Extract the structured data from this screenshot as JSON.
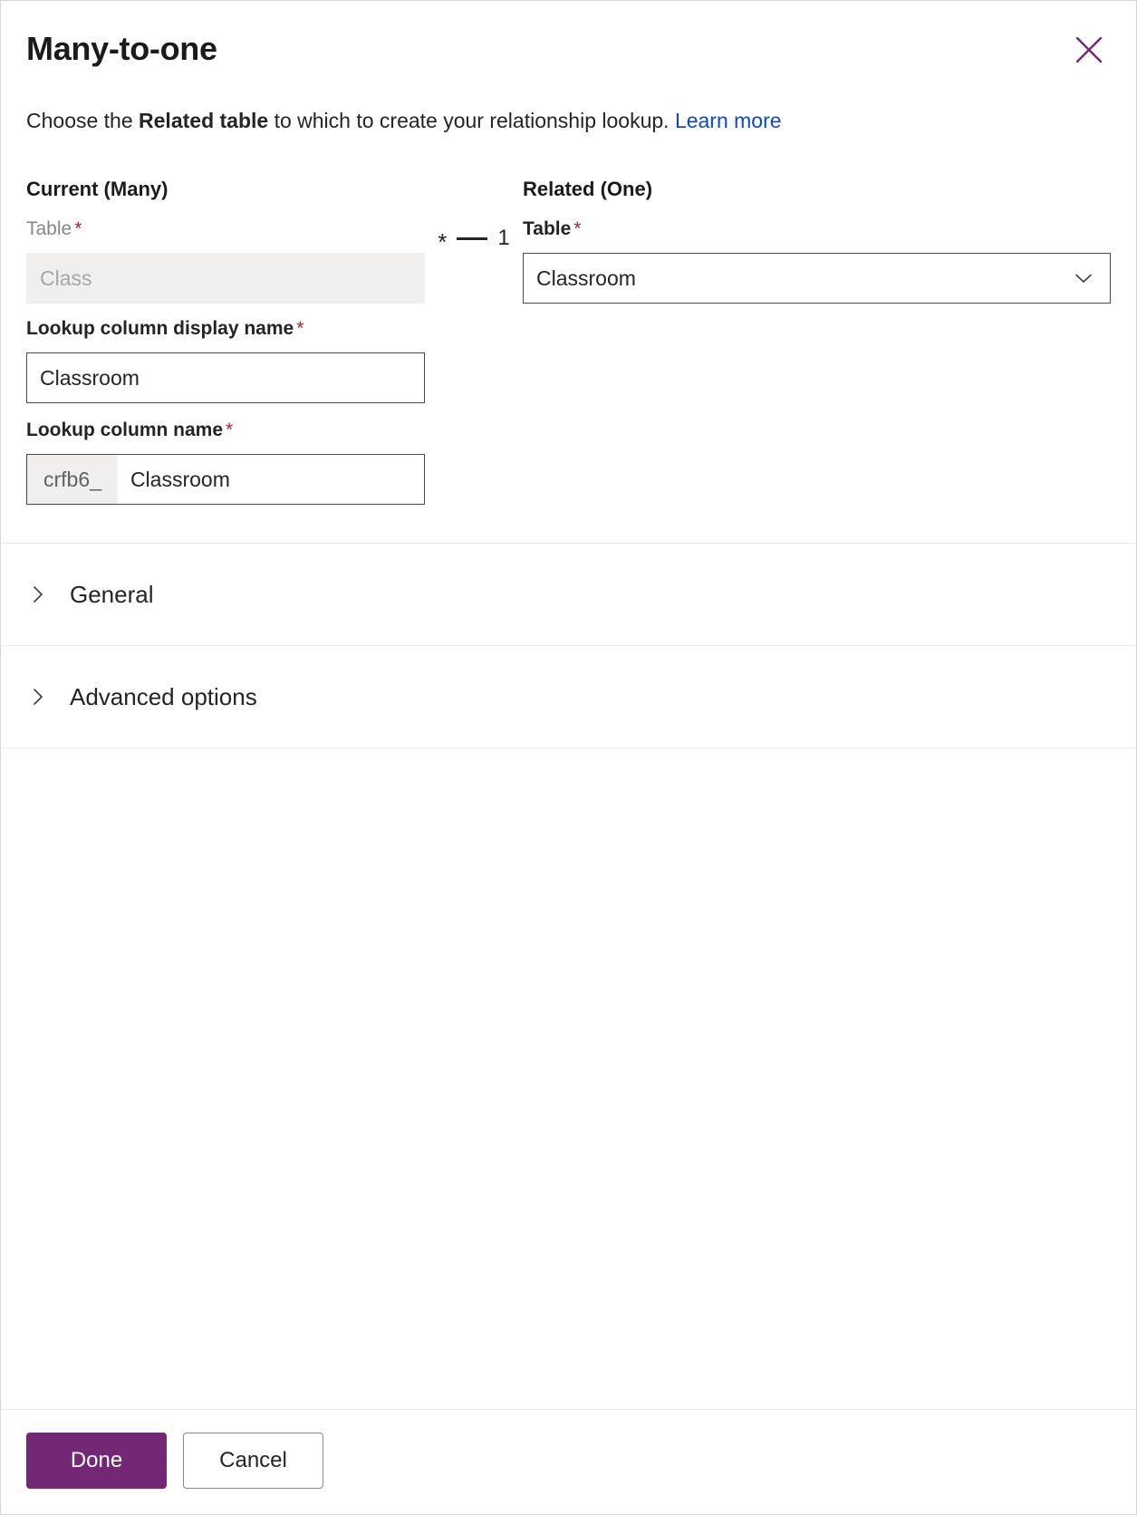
{
  "dialog": {
    "title": "Many-to-one",
    "close_icon": "close-icon",
    "subtitle": {
      "before": "Choose the ",
      "bold": "Related table",
      "after": " to which to create your relationship lookup. ",
      "link": "Learn more"
    }
  },
  "current": {
    "section_title": "Current (Many)",
    "table_label": "Table",
    "table_required": "*",
    "table_value": "Class",
    "table_disabled": true
  },
  "related": {
    "section_title": "Related (One)",
    "table_label": "Table",
    "table_required": "*",
    "table_value": "Classroom",
    "dropdown_icon": "chevron-down-icon"
  },
  "connector": {
    "many": "*",
    "one": "1"
  },
  "lookup_display": {
    "label": "Lookup column display name",
    "required": "*",
    "value": "Classroom"
  },
  "lookup_name": {
    "label": "Lookup column name",
    "required": "*",
    "prefix": "crfb6_",
    "value": "Classroom"
  },
  "accordions": [
    {
      "label": "General",
      "icon": "chevron-right-icon",
      "expanded": false
    },
    {
      "label": "Advanced options",
      "icon": "chevron-right-icon",
      "expanded": false
    }
  ],
  "footer": {
    "done_label": "Done",
    "cancel_label": "Cancel"
  },
  "colors": {
    "brand_purple": "#742774",
    "link_blue": "#0f47c2",
    "required_red": "#a4262c",
    "disabled_bg": "#f0efee"
  }
}
